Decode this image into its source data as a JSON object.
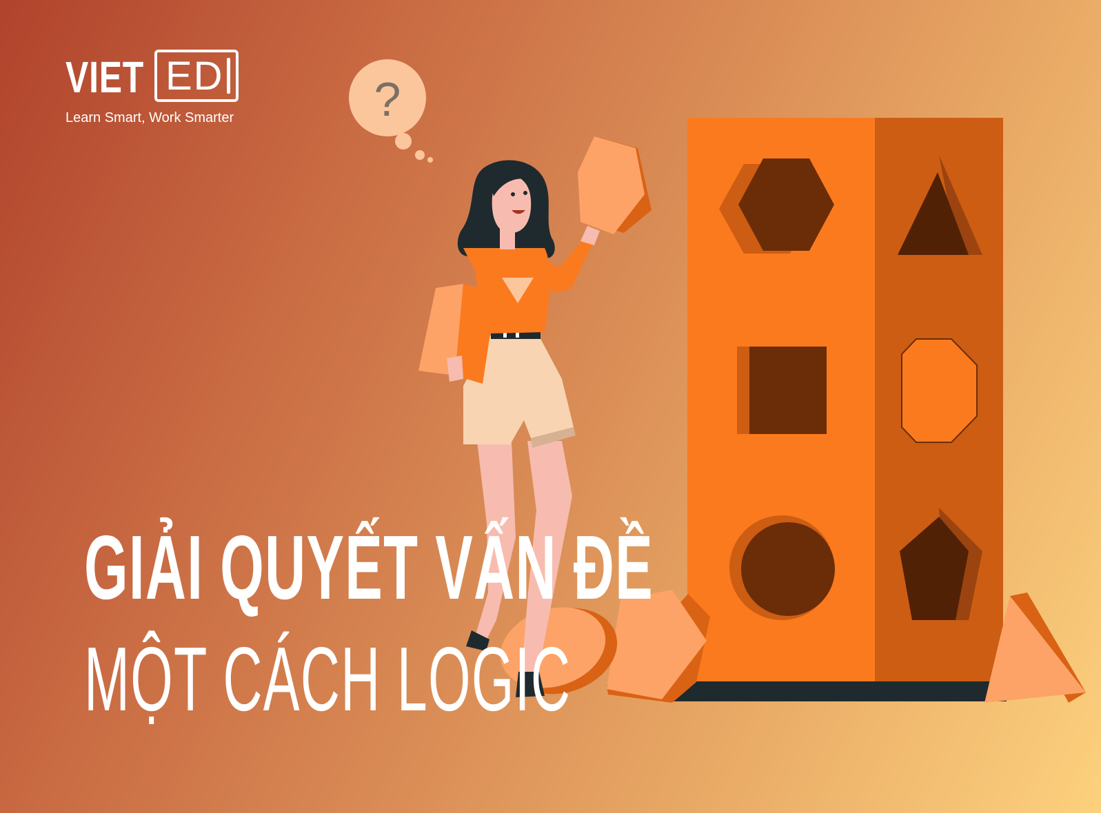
{
  "brand": {
    "word1": "VIET",
    "word2": "ED",
    "tagline": "Learn Smart, Work Smarter"
  },
  "thought_bubble": {
    "symbol": "?"
  },
  "headline": {
    "line1": "GIẢI QUYẾT VẤN ĐỀ",
    "line2": "MỘT CÁCH LOGIC"
  },
  "colors": {
    "background_start": "#b0432c",
    "background_end": "#fcd17d",
    "shape_sorter_front": "#fb7a1e",
    "shape_sorter_side": "#cc5d13",
    "hole_dark": "#6b2d08",
    "block_light": "#fda367",
    "text": "#ffffff"
  }
}
